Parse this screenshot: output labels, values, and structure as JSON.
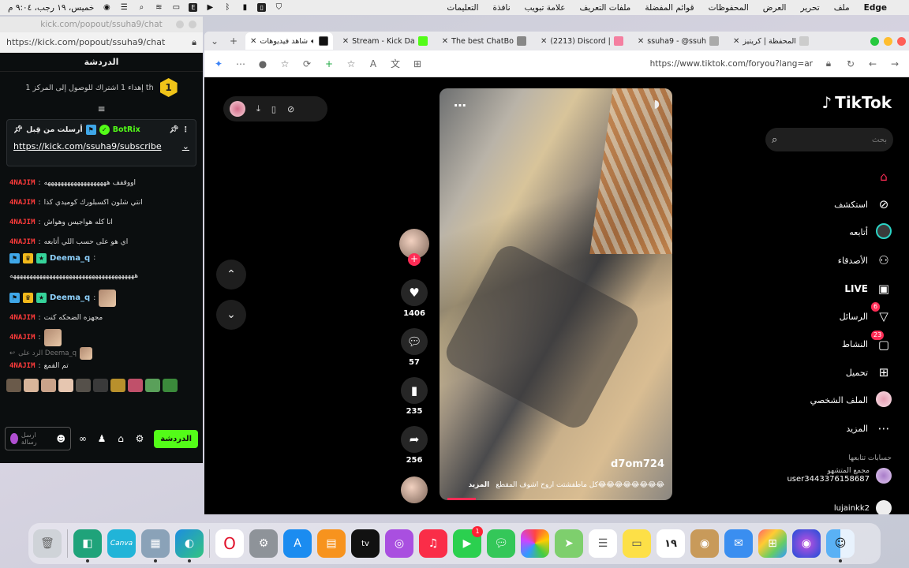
{
  "menubar": {
    "app_name": "Edge",
    "items": [
      "ملف",
      "تحرير",
      "العرض",
      "المحفوظات",
      "قوائم المفضلة",
      "ملفات التعريف",
      "علامة تبويب",
      "نافذة",
      "التعليمات"
    ],
    "clock": "خميس، ١٩ رجب، ٩:٠٤ م"
  },
  "kick": {
    "window_title": "kick.com/popout/ssuha9/chat",
    "url": "https://kick.com/popout/ssuha9/chat",
    "header_title": "الدردشة",
    "goal_badge": "1",
    "goal_text": "إهداء 1 اشتراك للوصول إلى المركز 1 th",
    "pinned": {
      "label": "أرسلت من قِبل",
      "bot_name": "BotRix",
      "link": "https://kick.com/ssuha9/subscribe"
    },
    "messages": [
      {
        "user": "4NAJIM",
        "text": "اووقفف هههههههههههههههههههه"
      },
      {
        "user": "4NAJIM",
        "text": "انتي شلون اكسبلورك كوميدي كذا"
      },
      {
        "user": "4NAJIM",
        "text": "انا كله هواجيس وهواش"
      },
      {
        "user": "4NAJIM",
        "text": "اي هو على حسب اللي أتابعه"
      },
      {
        "user": "Deema_q",
        "text": "ههههههههههههههههههههههههههههههههههههههه"
      },
      {
        "user": "Deema_q",
        "text": ""
      },
      {
        "user": "4NAJIM",
        "text": "مجهزه الضحكه كنت"
      },
      {
        "user": "4NAJIM",
        "text": ""
      },
      {
        "user": "4NAJIM",
        "reply_to": "الرد على Deema_q",
        "text": "تم القمع"
      }
    ],
    "input_placeholder": "ارسل رسالة",
    "chat_button": "الدردشة"
  },
  "browser": {
    "tabs": [
      {
        "label": "شاهد فيديوهات",
        "active": true,
        "color": "#111111"
      },
      {
        "label": "Stream - Kick Da",
        "active": false,
        "color": "#53fc18"
      },
      {
        "label": "The best ChatBo",
        "active": false,
        "color": "#888888"
      },
      {
        "label": "(2213) Discord |",
        "active": false,
        "color": "#f47fa0"
      },
      {
        "label": "ssuha9 - @ssuh",
        "active": false,
        "color": "#aaaaaa"
      },
      {
        "label": "المحفظة | كريتيز",
        "active": false,
        "color": "#cccccc"
      }
    ],
    "address": "https://www.tiktok.com/foryou?lang=ar"
  },
  "tiktok": {
    "logo": "TikTok",
    "search_placeholder": "بحث",
    "nav": [
      {
        "label": "",
        "icon": "home-icon"
      },
      {
        "label": "استكشف",
        "icon": "compass-icon"
      },
      {
        "label": "أتابعه",
        "icon": "following-icon"
      },
      {
        "label": "الأصدقاء",
        "icon": "friends-icon"
      },
      {
        "label": "LIVE",
        "icon": "live-icon"
      },
      {
        "label": "الرسائل",
        "icon": "messages-icon",
        "badge": "6"
      },
      {
        "label": "النشاط",
        "icon": "activity-icon",
        "badge": "23"
      },
      {
        "label": "تحميل",
        "icon": "upload-icon"
      },
      {
        "label": "الملف الشخصي",
        "icon": "profile-icon"
      },
      {
        "label": "المزيد",
        "icon": "more-icon"
      }
    ],
    "following_title": "حسابات تتابعها",
    "following": [
      {
        "name": "مجمع المتشهو",
        "handle": "user3443376158687"
      },
      {
        "name": "lujainkk2",
        "handle": ""
      }
    ],
    "video": {
      "username": "d7om724",
      "description": "كل ماطفشتت اروح اشوف المقطع😂😂😂😂😂😂😂😂",
      "more": "المزيد"
    },
    "actions": {
      "likes": "1406",
      "comments": "57",
      "saves": "235",
      "shares": "256"
    }
  },
  "dock": {
    "apps": [
      "trash",
      "finder-alt",
      "canva",
      "preview",
      "edge",
      "opera",
      "settings",
      "app-store",
      "books",
      "apple-tv",
      "podcasts",
      "music",
      "facetime",
      "messages",
      "photos",
      "maps",
      "reminders",
      "notes",
      "calendar",
      "contacts",
      "mail",
      "launchpad",
      "siri",
      "finder"
    ],
    "calendar_day": "١٩",
    "facetime_badge": "1"
  }
}
